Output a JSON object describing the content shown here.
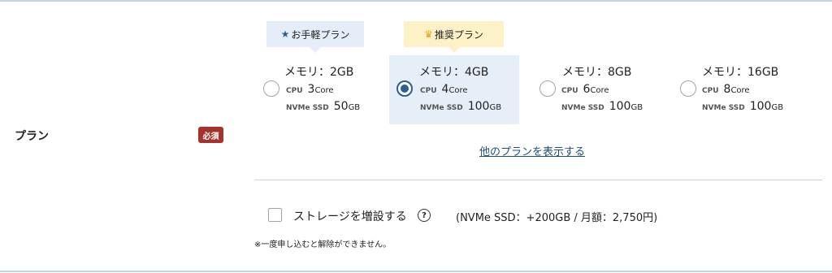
{
  "row": {
    "label": "プラン",
    "required_badge": "必須"
  },
  "tags": {
    "easy": {
      "icon": "star-icon",
      "icon_glyph": "★",
      "icon_color": "#2d5e96",
      "label": "お手軽プラン"
    },
    "recommended": {
      "icon": "crown-icon",
      "icon_glyph": "♛",
      "icon_color": "#e8a317",
      "label": "推奨プラン"
    }
  },
  "plans": [
    {
      "title": "メモリ：2GB",
      "cpu_label": "CPU",
      "cpu_value": "3",
      "cpu_unit": "Core",
      "ssd_label": "NVMe SSD",
      "ssd_value": "50",
      "ssd_unit": "GB",
      "selected": false
    },
    {
      "title": "メモリ：4GB",
      "cpu_label": "CPU",
      "cpu_value": "4",
      "cpu_unit": "Core",
      "ssd_label": "NVMe SSD",
      "ssd_value": "100",
      "ssd_unit": "GB",
      "selected": true
    },
    {
      "title": "メモリ：8GB",
      "cpu_label": "CPU",
      "cpu_value": "6",
      "cpu_unit": "Core",
      "ssd_label": "NVMe SSD",
      "ssd_value": "100",
      "ssd_unit": "GB",
      "selected": false
    },
    {
      "title": "メモリ：16GB",
      "cpu_label": "CPU",
      "cpu_value": "8",
      "cpu_unit": "Core",
      "ssd_label": "NVMe SSD",
      "ssd_value": "100",
      "ssd_unit": "GB",
      "selected": false
    }
  ],
  "more_plans_link": "他のプランを表示する",
  "storage": {
    "label": "ストレージを増設する",
    "help_icon": "?",
    "detail": "(NVMe SSD：+200GB / 月額：2,750円)",
    "checked": false
  },
  "note": "※一度申し込むと解除ができません。",
  "colors": {
    "accent": "#2d5e96",
    "badge": "#a5322c",
    "selected_bg": "#e6eef7",
    "tag_easy_bg": "#e5eef8",
    "tag_recommended_bg": "#fdf1c8"
  }
}
